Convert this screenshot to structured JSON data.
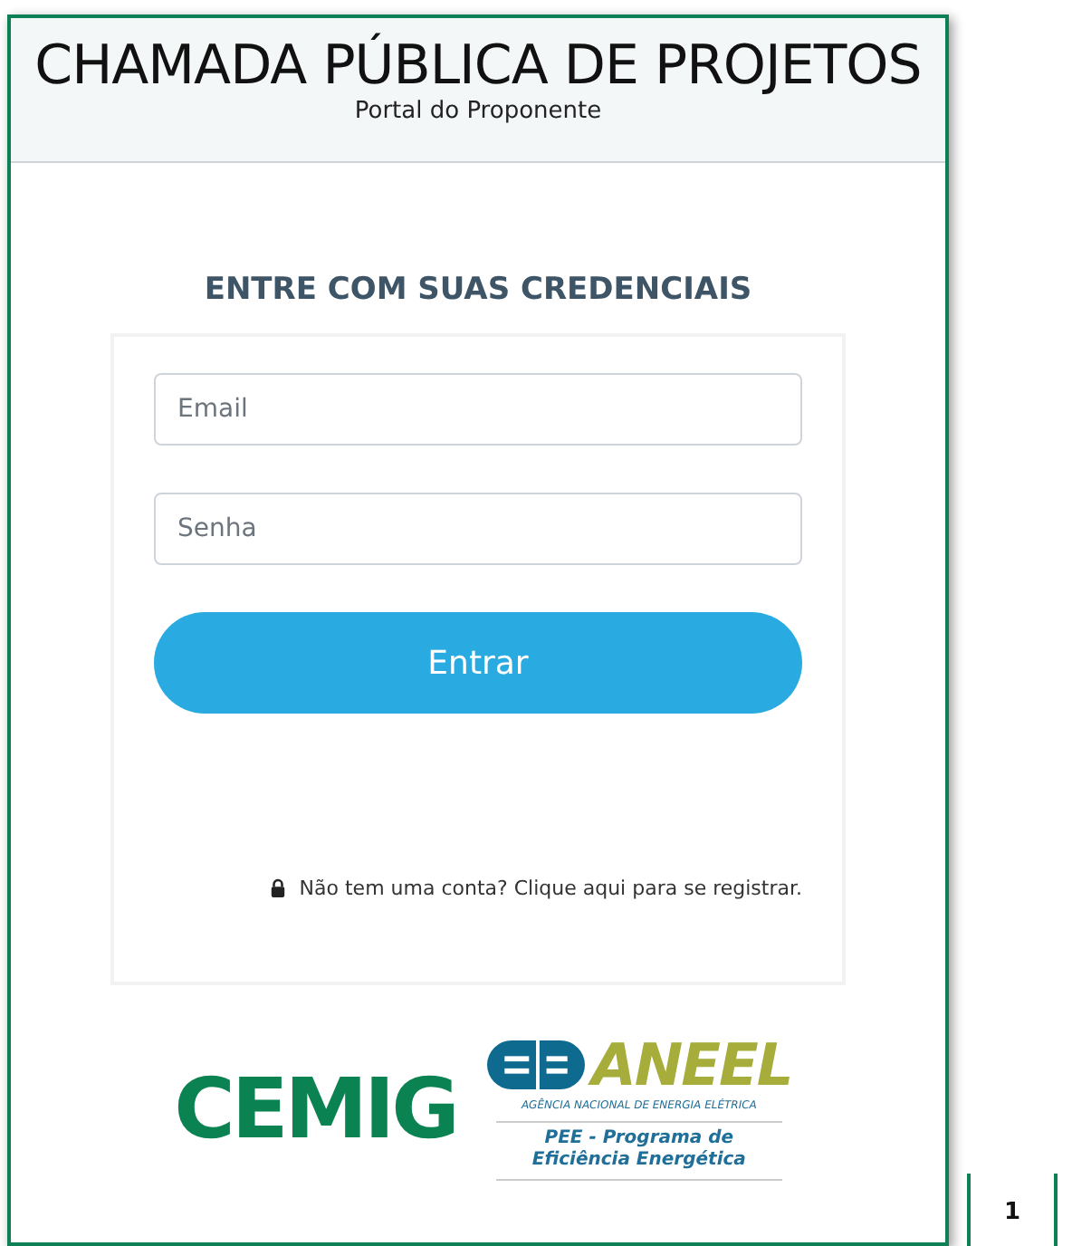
{
  "header": {
    "title": "CHAMADA PÚBLICA DE PROJETOS",
    "subtitle": "Portal do Proponente"
  },
  "login": {
    "heading": "ENTRE COM SUAS CREDENCIAIS",
    "fields": [
      {
        "placeholder": "Email"
      },
      {
        "placeholder": "Senha"
      }
    ],
    "button": "Entrar",
    "register_link": "Não tem uma conta? Clique aqui para se registrar."
  },
  "logos": {
    "cemig": "CEMIG",
    "aneel": {
      "name": "ANEEL",
      "agency": "AGÊNCIA NACIONAL DE ENERGIA ELÉTRICA",
      "program": "PEE - Programa de Eficiência Energética"
    }
  },
  "page_number": "1"
}
